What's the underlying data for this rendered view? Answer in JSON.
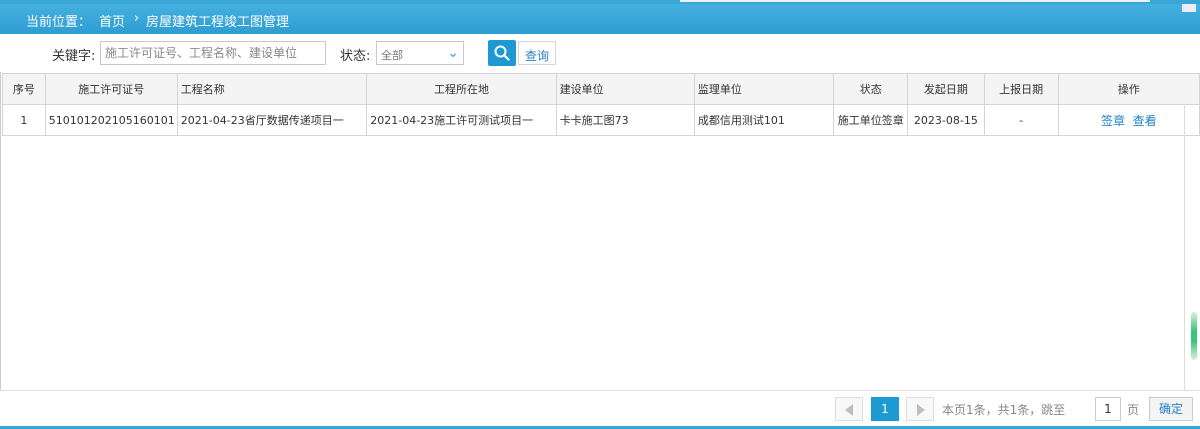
{
  "breadcrumb": {
    "location_label": "当前位置：",
    "home": "首页",
    "separator": "›",
    "current": "房屋建筑工程竣工图管理"
  },
  "search": {
    "keyword_label": "关键字:",
    "keyword_placeholder": "施工许可证号、工程名称、建设单位",
    "status_label": "状态:",
    "status_value": "全部",
    "query_label": "查询"
  },
  "table": {
    "columns": [
      "序号",
      "施工许可证号",
      "工程名称",
      "工程所在地",
      "建设单位",
      "监理单位",
      "状态",
      "发起日期",
      "上报日期",
      "操作"
    ],
    "rows": [
      {
        "index": "1",
        "permit_no": "510101202105160101",
        "project_name": "2021-04-23省厅数据传递项目一",
        "location": "2021-04-23施工许可测试项目一",
        "builder": "卡卡施工图73",
        "supervisor": "成都信用测试101",
        "status": "施工单位签章",
        "start_date": "2023-08-15",
        "report_date": "-",
        "actions": [
          "签章",
          "查看"
        ]
      }
    ]
  },
  "pager": {
    "current_page": "1",
    "info": "本页1条，共1条，跳至",
    "jump_value": "1",
    "page_unit": "页",
    "confirm": "确定"
  },
  "colors": {
    "header_blue": "#3aa6d6",
    "accent_blue": "#1e9ad3",
    "link_blue": "#1f83c6",
    "scroll_green": "#39c37b"
  }
}
